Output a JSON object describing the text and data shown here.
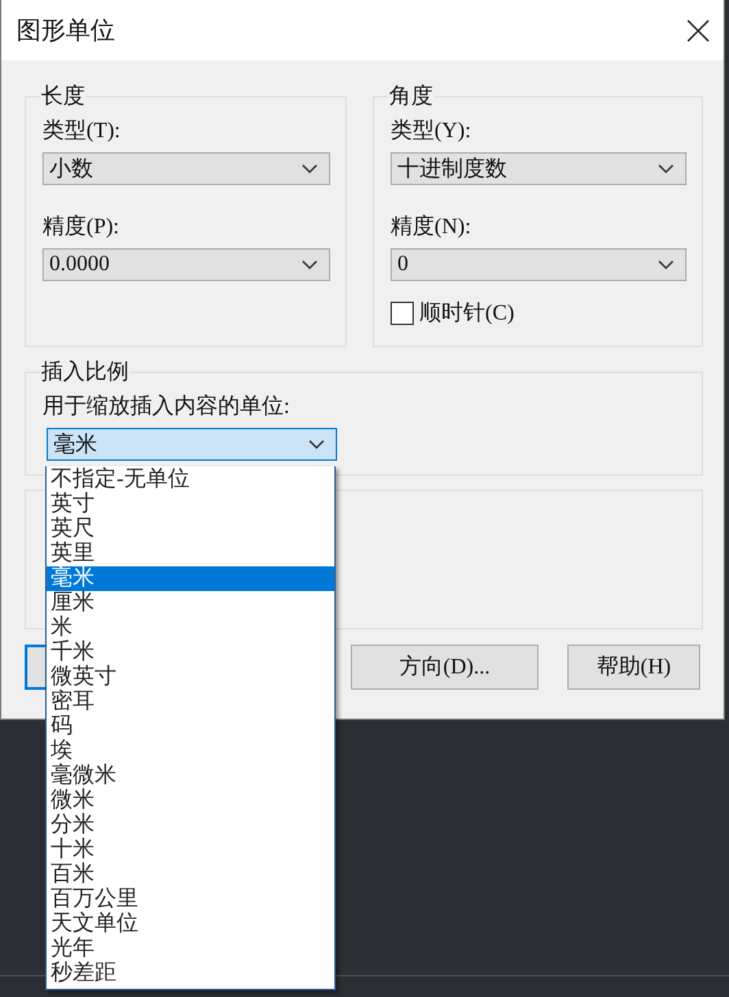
{
  "window": {
    "title": "图形单位"
  },
  "length": {
    "title": "长度",
    "type_label": "类型(T):",
    "type_value": "小数",
    "precision_label": "精度(P):",
    "precision_value": "0.0000"
  },
  "angle": {
    "title": "角度",
    "type_label": "类型(Y):",
    "type_value": "十进制度数",
    "precision_label": "精度(N):",
    "precision_value": "0",
    "clockwise": {
      "label": "顺时针(C)",
      "checked": false
    }
  },
  "insert_scale": {
    "title": "插入比例",
    "label": "用于缩放插入内容的单位:",
    "value": "毫米",
    "expanded": true,
    "options": [
      {
        "label": "不指定-无单位",
        "selected": false
      },
      {
        "label": "英寸",
        "selected": false
      },
      {
        "label": "英尺",
        "selected": false
      },
      {
        "label": "英里",
        "selected": false
      },
      {
        "label": "毫米",
        "selected": true
      },
      {
        "label": "厘米",
        "selected": false
      },
      {
        "label": "米",
        "selected": false
      },
      {
        "label": "千米",
        "selected": false
      },
      {
        "label": "微英寸",
        "selected": false
      },
      {
        "label": "密耳",
        "selected": false
      },
      {
        "label": "码",
        "selected": false
      },
      {
        "label": "埃",
        "selected": false
      },
      {
        "label": "毫微米",
        "selected": false
      },
      {
        "label": "微米",
        "selected": false
      },
      {
        "label": "分米",
        "selected": false
      },
      {
        "label": "十米",
        "selected": false
      },
      {
        "label": "百米",
        "selected": false
      },
      {
        "label": "百万公里",
        "selected": false
      },
      {
        "label": "天文单位",
        "selected": false
      },
      {
        "label": "光年",
        "selected": false
      },
      {
        "label": "秒差距",
        "selected": false
      }
    ]
  },
  "buttons": [
    {
      "label": "方向(D)..."
    },
    {
      "label": "帮助(H)"
    }
  ]
}
